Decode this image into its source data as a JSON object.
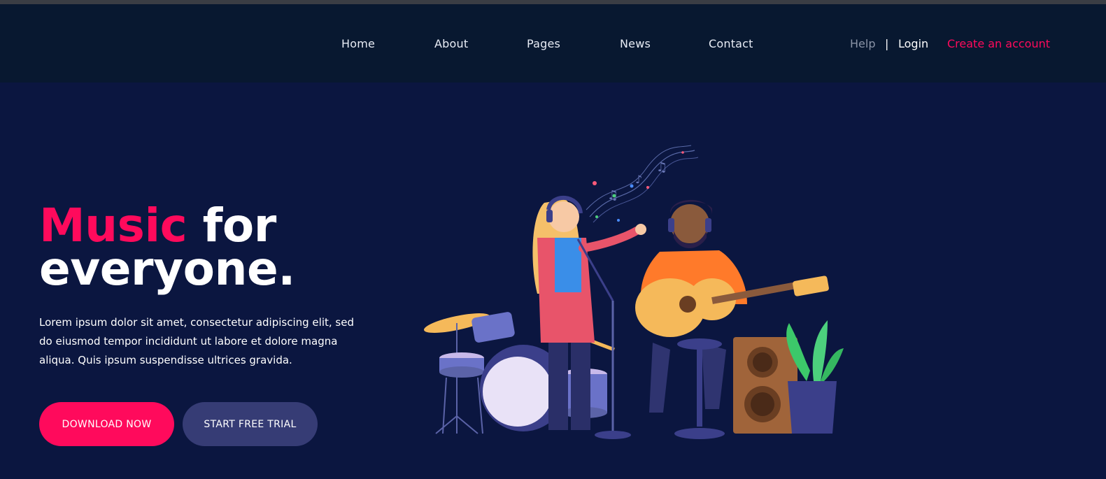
{
  "nav": {
    "items": [
      "Home",
      "About",
      "Pages",
      "News",
      "Contact"
    ],
    "help": "Help",
    "separator": "|",
    "login": "Login",
    "create_account": "Create an account"
  },
  "hero": {
    "title_accent": "Music",
    "title_rest": " for",
    "title_line2": "everyone.",
    "description": "Lorem ipsum dolor sit amet, consectetur adipiscing elit, sed do eiusmod tempor incididunt ut labore et dolore magna aliqua. Quis ipsum suspendisse ultrices gravida.",
    "primary_button": "DOWNLOAD NOW",
    "secondary_button": "START FREE TRIAL"
  },
  "colors": {
    "background": "#0b1640",
    "header": "#081830",
    "accent": "#ff0a5c",
    "secondary_button": "#363c75"
  },
  "illustration": {
    "icon": "band-illustration"
  }
}
